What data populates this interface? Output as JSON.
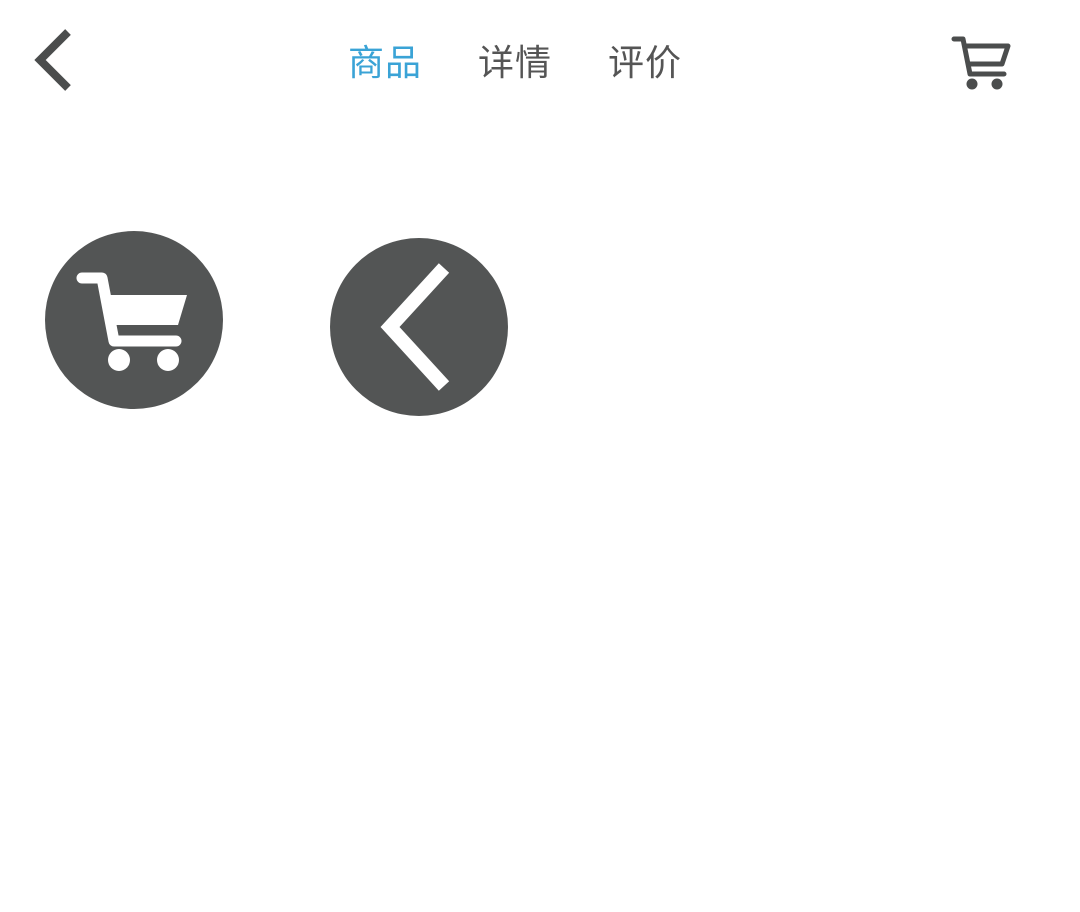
{
  "header": {
    "back_icon": "chevron-left-icon",
    "cart_icon": "shopping-cart-icon",
    "icon_color": "#4b4d4d",
    "tabs": [
      {
        "label": "商品",
        "active": true
      },
      {
        "label": "详情",
        "active": false
      },
      {
        "label": "评价",
        "active": false
      }
    ],
    "active_color": "#3aa3d6",
    "inactive_color": "#555555"
  },
  "floating_buttons": {
    "background_color": "#535555",
    "icon_color": "#ffffff",
    "cart_icon": "shopping-cart-icon",
    "back_icon": "chevron-left-icon"
  }
}
